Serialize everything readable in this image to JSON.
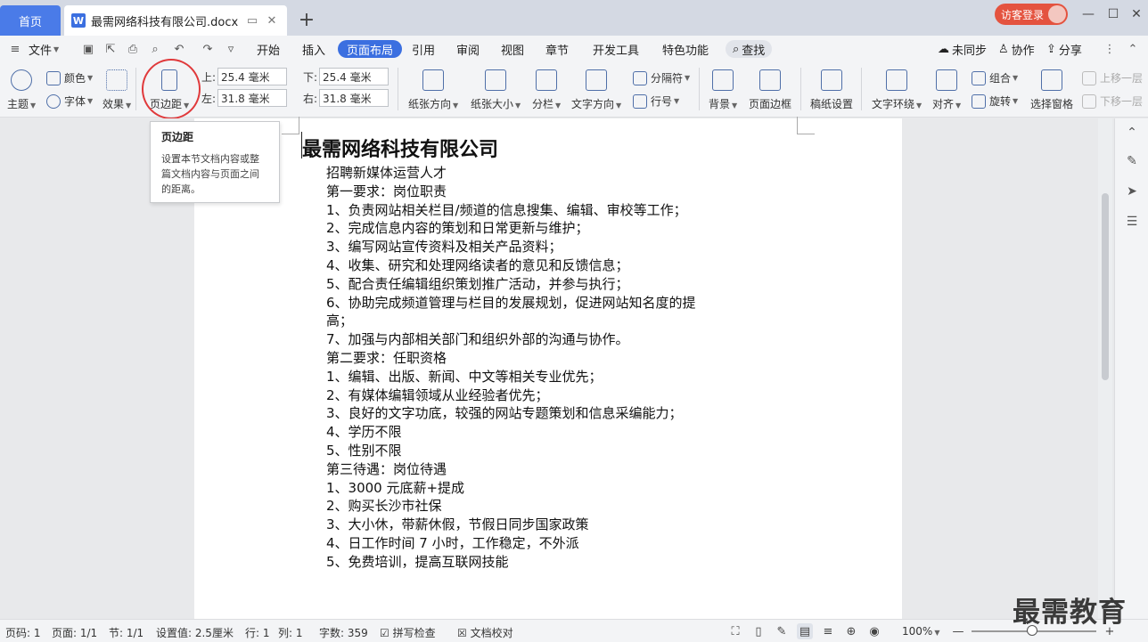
{
  "tabs": {
    "home": "首页",
    "doc_title": "最需网络科技有限公司.docx",
    "doc_icon": "W"
  },
  "visitor_label": "访客登录",
  "menu": {
    "file": "文件",
    "items": [
      "开始",
      "插入",
      "页面布局",
      "引用",
      "审阅",
      "视图",
      "章节",
      "开发工具",
      "特色功能"
    ],
    "active": "页面布局",
    "search": "查找",
    "unsynced": "未同步",
    "collab": "协作",
    "share": "分享"
  },
  "ribbon": {
    "theme": "主题",
    "color": "颜色",
    "font": "字体",
    "effect": "效果",
    "margin": "页边距",
    "top_label": "上:",
    "top_value": "25.4 毫米",
    "bottom_label": "下:",
    "bottom_value": "25.4 毫米",
    "left_label": "左:",
    "left_value": "31.8 毫米",
    "right_label": "右:",
    "right_value": "31.8 毫米",
    "orientation": "纸张方向",
    "size": "纸张大小",
    "columns": "分栏",
    "text_direction": "文字方向",
    "separator": "分隔符",
    "line_number": "行号",
    "background": "背景",
    "page_border": "页面边框",
    "paper_setup": "稿纸设置",
    "text_wrap": "文字环绕",
    "align": "对齐",
    "group": "组合",
    "rotate": "旋转",
    "select_pane": "选择窗格",
    "move_up": "上移一层",
    "move_down": "下移一层"
  },
  "tooltip": {
    "title": "页边距",
    "body": "设置本节文档内容或整篇文档内容与页面之间的距离。"
  },
  "document": {
    "title": "最需网络科技有限公司",
    "lines": [
      "招聘新媒体运营人才",
      "第一要求：岗位职责",
      "1、负责网站相关栏目/频道的信息搜集、编辑、审校等工作；",
      "2、完成信息内容的策划和日常更新与维护；",
      "3、编写网站宣传资料及相关产品资料；",
      "4、收集、研究和处理网络读者的意见和反馈信息；",
      "5、配合责任编辑组织策划推广活动，并参与执行；",
      "6、协助完成频道管理与栏目的发展规划，促进网站知名度的提",
      "高；",
      "7、加强与内部相关部门和组织外部的沟通与协作。",
      "第二要求：任职资格",
      "1、编辑、出版、新闻、中文等相关专业优先；",
      "2、有媒体编辑领域从业经验者优先；",
      "3、良好的文字功底，较强的网站专题策划和信息采编能力；",
      "4、学历不限",
      "5、性别不限",
      "第三待遇：岗位待遇",
      "1、3000 元底薪+提成",
      "2、购买长沙市社保",
      "3、大小休，带薪休假，节假日同步国家政策",
      "4、日工作时间 7 小时，工作稳定，不外派",
      "5、免费培训，提高互联网技能"
    ]
  },
  "status": {
    "page_code": "页码: 1",
    "page": "页面: 1/1",
    "section": "节: 1/1",
    "setting": "设置值: 2.5厘米",
    "row": "行: 1",
    "col": "列: 1",
    "words": "字数: 359",
    "spell": "拼写检查",
    "proof": "文档校对",
    "zoom": "100%"
  },
  "watermark": "最需教育",
  "colors": {
    "accent": "#3b6fe0",
    "tab_home": "#4a7be8",
    "visitor": "#e4533f",
    "highlight": "#e0393b"
  }
}
